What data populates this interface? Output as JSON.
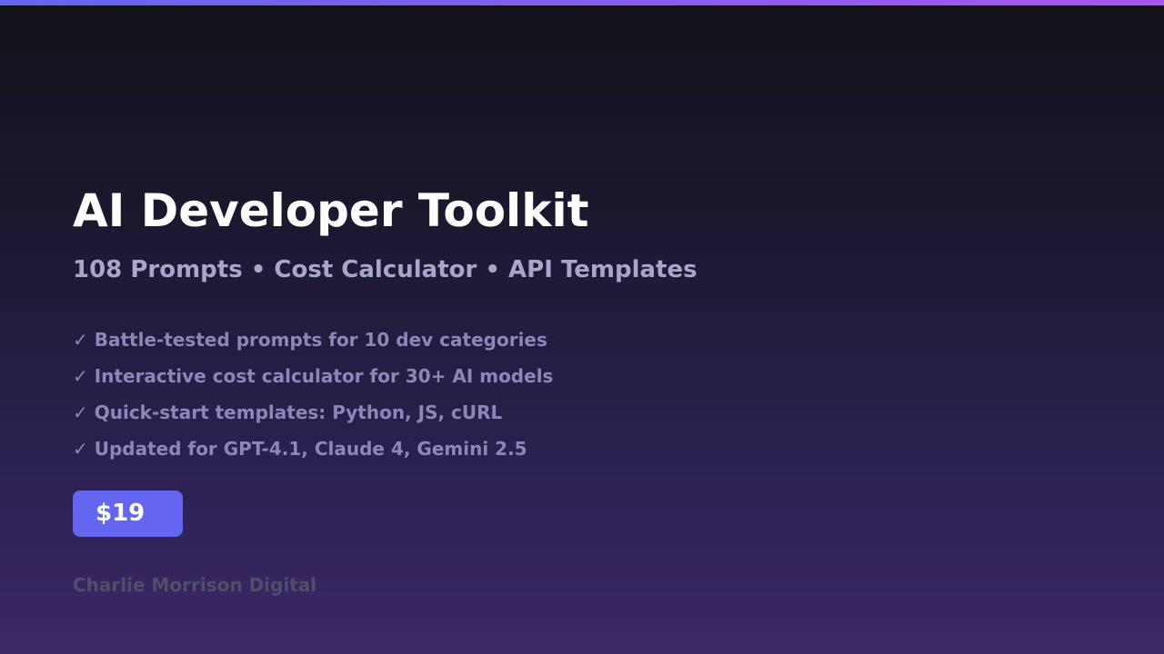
{
  "title": "AI Developer Toolkit",
  "subtitle": "108 Prompts • Cost Calculator • API Templates",
  "features": [
    "✓ Battle-tested prompts for 10 dev categories",
    "✓ Interactive cost calculator for 30+ AI models",
    "✓ Quick-start templates: Python, JS, cURL",
    "✓ Updated for GPT-4.1, Claude 4, Gemini 2.5"
  ],
  "price": "$19",
  "brand": "Charlie Morrison Digital",
  "colors": {
    "accent": "#6366f1",
    "accent_end": "#a855f7"
  }
}
